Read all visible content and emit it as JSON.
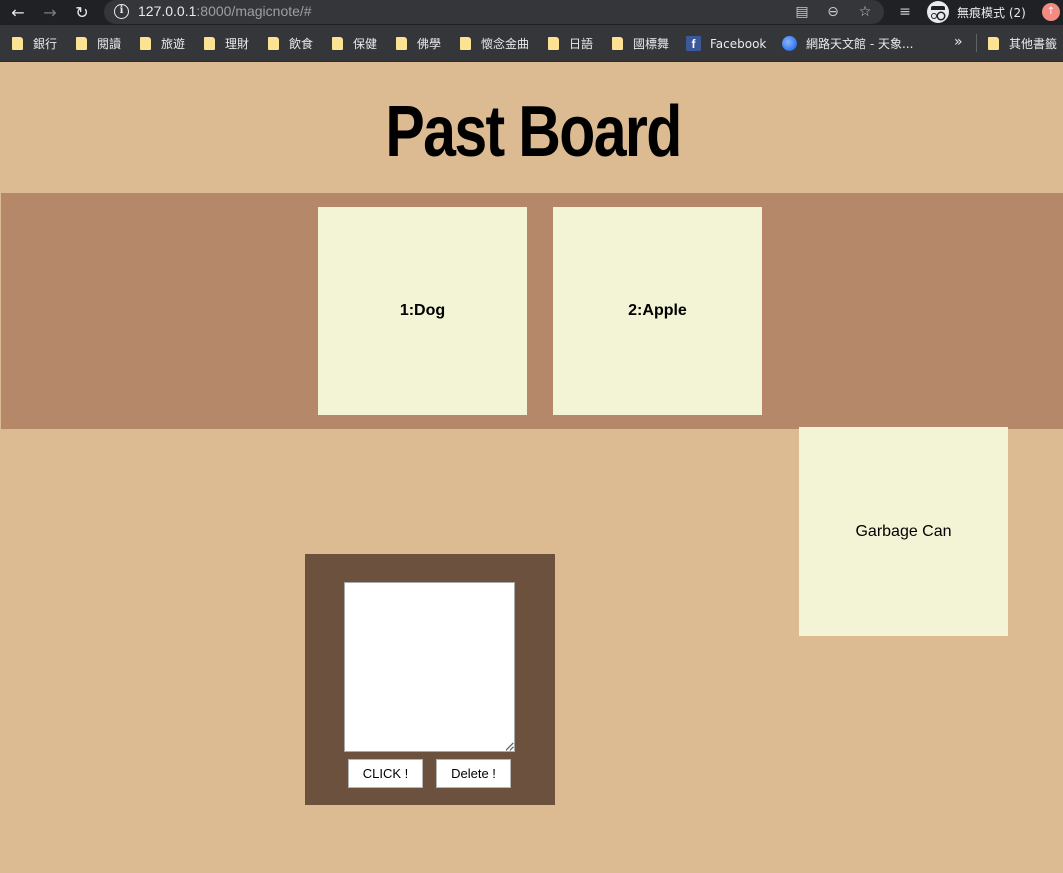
{
  "browser": {
    "url_host": "127.0.0.1",
    "url_path": ":8000/magicnote/#",
    "incognito_label": "無痕模式 (2)",
    "bookmarks": [
      {
        "label": "銀行",
        "icon": "folder-icon"
      },
      {
        "label": "閱讀",
        "icon": "folder-icon"
      },
      {
        "label": "旅遊",
        "icon": "folder-icon"
      },
      {
        "label": "理財",
        "icon": "folder-icon"
      },
      {
        "label": "飲食",
        "icon": "folder-icon"
      },
      {
        "label": "保健",
        "icon": "folder-icon"
      },
      {
        "label": "佛學",
        "icon": "folder-icon"
      },
      {
        "label": "懷念金曲",
        "icon": "folder-icon"
      },
      {
        "label": "日語",
        "icon": "folder-icon"
      },
      {
        "label": "國標舞",
        "icon": "folder-icon"
      },
      {
        "label": "Facebook",
        "icon": "facebook-icon"
      },
      {
        "label": "網路天文館 - 天象...",
        "icon": "globe-icon"
      }
    ],
    "other_bookmarks": "其他書籤",
    "more_symbol": "»"
  },
  "page": {
    "title": "Past Board",
    "notes": [
      {
        "text": "1:Dog"
      },
      {
        "text": "2:Apple"
      }
    ],
    "garbage_label": "Garbage Can",
    "editor": {
      "textarea_value": "",
      "click_label": "CLICK !",
      "delete_label": "Delete !"
    }
  },
  "colors": {
    "background": "#dcbb93",
    "board": "#b48868",
    "note": "#f3f3d6",
    "editor_panel": "#6c513f"
  }
}
